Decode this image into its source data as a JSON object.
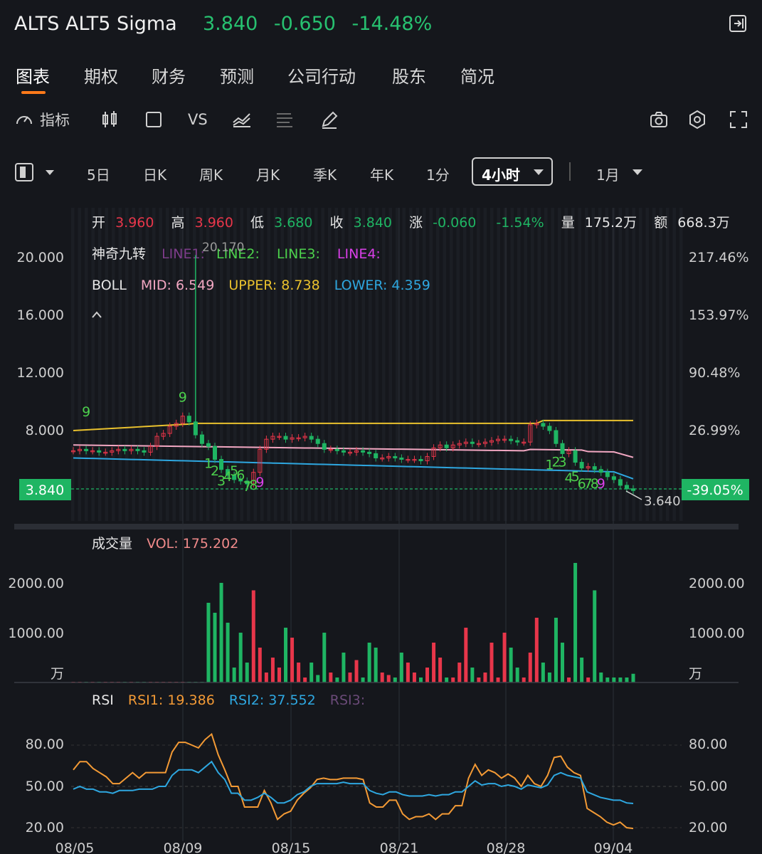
{
  "header": {
    "title": "ALTS ALT5 Sigma",
    "price": "3.840",
    "change": "-0.650",
    "change_pct": "-14.48%"
  },
  "tabs": [
    "图表",
    "期权",
    "财务",
    "预测",
    "公司行动",
    "股东",
    "简况"
  ],
  "toolbar": {
    "indicator_label": "指标",
    "vs_label": "VS"
  },
  "periods": {
    "items": [
      "5日",
      "日K",
      "周K",
      "月K",
      "季K",
      "年K",
      "1分"
    ],
    "selected": "4小时",
    "range": "1月"
  },
  "ohlc": {
    "open_label": "开",
    "open": "3.960",
    "high_label": "高",
    "high": "3.960",
    "low_label": "低",
    "low": "3.680",
    "close_label": "收",
    "close": "3.840",
    "chg_label": "涨",
    "chg": "-0.060",
    "chg_pct": "-1.54%",
    "vol_label": "量",
    "vol": "175.2万",
    "amt_label": "额",
    "amt": "668.3万"
  },
  "legend_magic": {
    "name": "神奇九转",
    "line1": "LINE1:",
    "line2": "LINE2:",
    "line3": "LINE3:",
    "line4": "LINE4:",
    "peak": "20.170"
  },
  "legend_boll": {
    "name": "BOLL",
    "mid": "MID: 6.549",
    "upper": "UPPER: 8.738",
    "lower": "LOWER: 4.359"
  },
  "price_axis": [
    "20.000",
    "16.000",
    "12.000",
    "8.000"
  ],
  "pct_axis": [
    "217.46%",
    "153.97%",
    "90.48%",
    "26.99%"
  ],
  "last_price_tag": "3.840",
  "last_pct_tag": "-39.05%",
  "low_marker": "3.640",
  "volume": {
    "name": "成交量",
    "value": "VOL: 175.202",
    "axis": [
      "2000.00",
      "1000.00"
    ],
    "unit": "万"
  },
  "rsi": {
    "name": "RSI",
    "rsi1": "RSI1: 19.386",
    "rsi2": "RSI2: 37.552",
    "rsi3": "RSI3:",
    "axis": [
      "80.00",
      "50.00",
      "20.00"
    ]
  },
  "x_axis": [
    "08/05",
    "08/09",
    "08/15",
    "08/21",
    "08/28",
    "09/04"
  ],
  "colors": {
    "up": "#e8364a",
    "down": "#1fb563",
    "boll_mid": "#f2a7c2",
    "boll_upper": "#e9c12e",
    "boll_lower": "#2ea7e0",
    "rsi1": "#f39a35",
    "rsi2": "#2ea7e0",
    "accent": "#ff7a1a"
  },
  "chart_data": [
    {
      "type": "candlestick",
      "title": "",
      "x": [
        "08/05",
        "08/09",
        "08/15",
        "08/21",
        "08/28",
        "09/04"
      ],
      "y_axis_ticks": [
        8,
        12,
        16,
        20
      ],
      "ylim": [
        3.4,
        21
      ],
      "closes": [
        6.6,
        6.7,
        6.6,
        6.6,
        6.5,
        6.5,
        6.6,
        6.7,
        6.6,
        6.7,
        6.6,
        6.5,
        6.9,
        7.6,
        7.8,
        8.3,
        8.5,
        9.0,
        8.6,
        7.7,
        7.1,
        6.9,
        6.0,
        5.3,
        4.9,
        4.6,
        4.5,
        4.3,
        5.1,
        6.7,
        7.4,
        7.6,
        7.6,
        7.4,
        7.5,
        7.5,
        7.6,
        7.4,
        7.1,
        6.7,
        6.7,
        6.6,
        6.5,
        6.5,
        6.6,
        6.5,
        6.4,
        6.1,
        6.1,
        6.2,
        6.1,
        6.0,
        6.0,
        6.0,
        5.9,
        6.2,
        6.8,
        7.0,
        6.8,
        7.0,
        7.1,
        7.2,
        7.1,
        7.1,
        7.2,
        7.3,
        7.4,
        7.4,
        7.3,
        7.2,
        7.2,
        8.4,
        8.5,
        8.3,
        8.0,
        7.1,
        6.4,
        6.6,
        5.8,
        5.4,
        5.5,
        5.3,
        5.1,
        4.8,
        4.6,
        4.2,
        3.96,
        3.84
      ],
      "high_spike": 20.17,
      "last_low": 3.64
    },
    {
      "type": "bar",
      "title": "成交量",
      "ylabel": "万",
      "y_axis_ticks": [
        1000,
        2000
      ],
      "values": [
        10,
        10,
        10,
        10,
        10,
        10,
        10,
        10,
        10,
        10,
        10,
        10,
        10,
        10,
        10,
        10,
        10,
        10,
        10,
        10,
        10,
        1600,
        1400,
        2000,
        1200,
        300,
        1000,
        400,
        1850,
        700,
        200,
        500,
        300,
        1100,
        900,
        400,
        100,
        400,
        150,
        1000,
        200,
        100,
        600,
        200,
        450,
        100,
        800,
        700,
        200,
        150,
        100,
        600,
        400,
        200,
        100,
        300,
        800,
        500,
        100,
        100,
        400,
        1100,
        300,
        100,
        200,
        800,
        100,
        1000,
        700,
        300,
        100,
        600,
        1300,
        400,
        200,
        1300,
        800,
        100,
        2400,
        500,
        100,
        1850,
        200,
        100,
        100,
        100,
        100,
        175
      ],
      "last_value": 175.202
    },
    {
      "type": "line",
      "title": "RSI",
      "y_axis_ticks": [
        20,
        50,
        80
      ],
      "ylim": [
        15,
        92
      ],
      "series": [
        {
          "name": "RSI1",
          "values": [
            62,
            68,
            68,
            63,
            60,
            57,
            52,
            52,
            56,
            60,
            56,
            60,
            60,
            60,
            60,
            75,
            82,
            82,
            80,
            78,
            84,
            88,
            73,
            62,
            50,
            50,
            35,
            35,
            35,
            47,
            38,
            26,
            30,
            32,
            40,
            45,
            49,
            55,
            56,
            55,
            55,
            56,
            56,
            56,
            55,
            38,
            35,
            35,
            40,
            40,
            30,
            26,
            28,
            28,
            30,
            26,
            30,
            30,
            36,
            36,
            56,
            66,
            58,
            62,
            60,
            56,
            59,
            56,
            50,
            58,
            52,
            50,
            58,
            71,
            72,
            64,
            60,
            58,
            34,
            31,
            28,
            24,
            22,
            24,
            20,
            19.386
          ]
        },
        {
          "name": "RSI2",
          "values": [
            48,
            50,
            48,
            48,
            46,
            46,
            45,
            47,
            47,
            47,
            48,
            48,
            48,
            50,
            50,
            58,
            62,
            62,
            62,
            60,
            64,
            68,
            60,
            55,
            45,
            45,
            40,
            40,
            42,
            45,
            42,
            38,
            38,
            40,
            44,
            46,
            50,
            52,
            52,
            52,
            52,
            53,
            52,
            52,
            52,
            47,
            45,
            44,
            46,
            46,
            44,
            43,
            43,
            43,
            44,
            43,
            44,
            44,
            46,
            46,
            50,
            54,
            51,
            52,
            52,
            50,
            51,
            50,
            48,
            51,
            50,
            49,
            51,
            58,
            60,
            58,
            57,
            56,
            46,
            44,
            42,
            41,
            40,
            40,
            38,
            37.552
          ]
        }
      ]
    }
  ]
}
